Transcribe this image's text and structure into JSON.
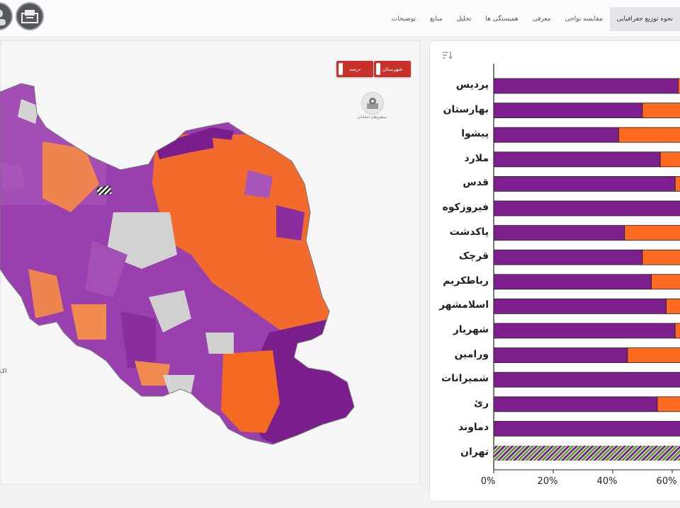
{
  "topbar": {
    "nav": [
      {
        "label": "نحوه توزیع جغرافیایی",
        "active": true
      },
      {
        "label": "مقایسه نواحی",
        "active": false
      },
      {
        "label": "معرفی",
        "active": false
      },
      {
        "label": "همبستگی ها",
        "active": false
      },
      {
        "label": "تحلیل",
        "active": false
      },
      {
        "label": "منابع",
        "active": false
      },
      {
        "label": "توضیحات",
        "active": false
      }
    ]
  },
  "map_panel": {
    "toggle_county": "شهرستان",
    "toggle_percent": "درصد",
    "layers_label": "سطوح‌های انتخاباتی",
    "partial_label": "اک",
    "colors": {
      "purple": "#8b2a9b",
      "orange": "#ff6a21",
      "light_purple": "#a855b8",
      "light_orange": "#f08a4e",
      "no_data": "#d4d4d4"
    }
  },
  "chart_data": {
    "type": "bar",
    "orientation": "horizontal",
    "stacked": true,
    "categories": [
      "پردیس",
      "بهارستان",
      "پیشوا",
      "ملارد",
      "قدس",
      "فیروزکوه",
      "پاکدشت",
      "قرچک",
      "رباطکریم",
      "اسلامشهر",
      "شهریار",
      "ورامین",
      "شمیرانات",
      "ریٔ",
      "دماوند",
      "تهران"
    ],
    "series": [
      {
        "color": "#7e1f8e",
        "values": [
          62,
          50,
          42,
          56,
          61,
          68,
          44,
          50,
          53,
          58,
          61,
          45,
          72,
          55,
          68,
          50
        ]
      },
      {
        "color": "#ff6a21",
        "values": [
          38,
          50,
          58,
          44,
          39,
          32,
          56,
          50,
          47,
          42,
          39,
          55,
          28,
          45,
          32,
          50
        ]
      }
    ],
    "hatched_last": true,
    "xlim": [
      0,
      100
    ],
    "xticks": [
      "0%",
      "20%",
      "40%",
      "60%"
    ]
  }
}
